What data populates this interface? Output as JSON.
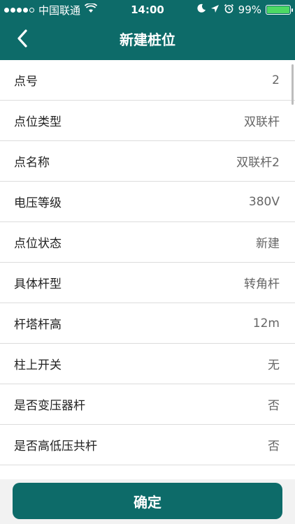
{
  "status_bar": {
    "carrier": "中国联通",
    "time": "14:00",
    "battery_text": "99%",
    "battery_level": 0.99,
    "signal_bars_filled": 4,
    "signal_bars_total": 5,
    "icons": [
      "signal-dots-icon",
      "wifi-icon",
      "moon-icon",
      "location-arrow-icon",
      "alarm-icon",
      "battery-icon"
    ]
  },
  "nav": {
    "title": "新建桩位",
    "back_icon": "chevron-left-icon"
  },
  "fields": [
    {
      "label": "点号",
      "value": "2"
    },
    {
      "label": "点位类型",
      "value": "双联杆"
    },
    {
      "label": "点名称",
      "value": "双联杆2"
    },
    {
      "label": "电压等级",
      "value": "380V"
    },
    {
      "label": "点位状态",
      "value": "新建"
    },
    {
      "label": "具体杆型",
      "value": "转角杆"
    },
    {
      "label": "杆塔杆高",
      "value": "12m"
    },
    {
      "label": "柱上开关",
      "value": "无"
    },
    {
      "label": "是否变压器杆",
      "value": "否"
    },
    {
      "label": "是否高低压共杆",
      "value": "否"
    }
  ],
  "footer": {
    "confirm_label": "确定"
  },
  "colors": {
    "primary": "#0d6b69",
    "battery": "#4cd964"
  }
}
